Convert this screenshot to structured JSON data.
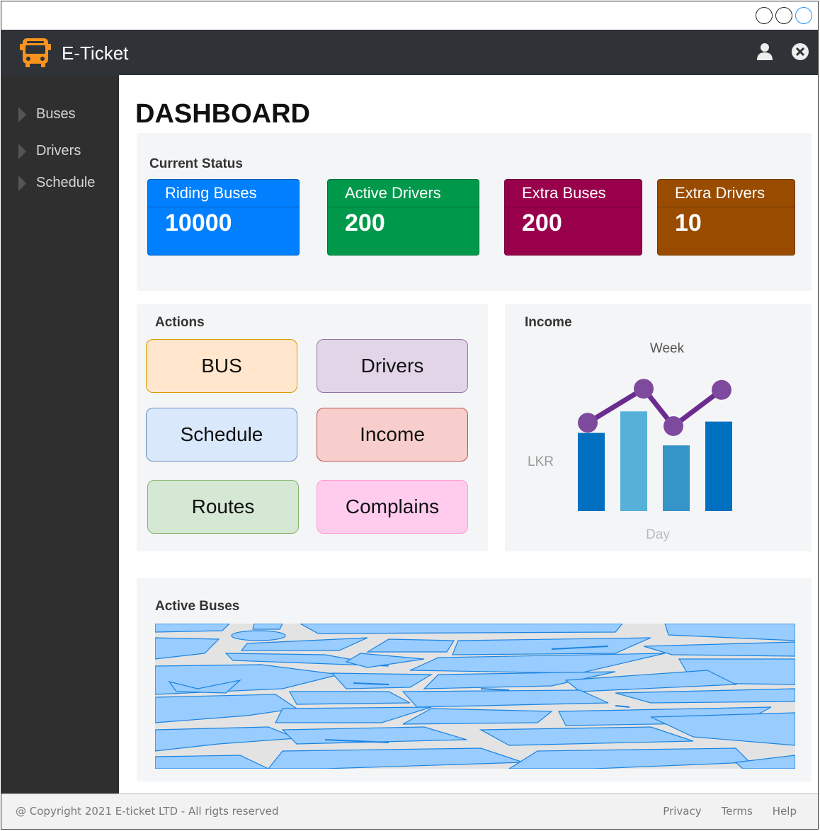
{
  "app": {
    "title": "E-Ticket"
  },
  "sidebar": {
    "items": [
      {
        "label": "Buses"
      },
      {
        "label": "Drivers"
      },
      {
        "label": "Schedule"
      }
    ]
  },
  "page": {
    "title": "DASHBOARD"
  },
  "status": {
    "title": "Current Status",
    "cards": [
      {
        "label": "Riding Buses",
        "value": "10000",
        "color": "#0080ff"
      },
      {
        "label": "Active Drivers",
        "value": "200",
        "color": "#00994c"
      },
      {
        "label": "Extra Buses",
        "value": "200",
        "color": "#99004c"
      },
      {
        "label": "Extra Drivers",
        "value": "10",
        "color": "#994c00"
      }
    ]
  },
  "actions": {
    "title": "Actions",
    "buttons": [
      {
        "label": "BUS",
        "fill": "#ffe6cc",
        "border": "#d79b00"
      },
      {
        "label": "Drivers",
        "fill": "#e1d5e7",
        "border": "#9673a6"
      },
      {
        "label": "Schedule",
        "fill": "#dae8fc",
        "border": "#6c8ebf"
      },
      {
        "label": "Income",
        "fill": "#f8cecc",
        "border": "#b85450"
      },
      {
        "label": "Routes",
        "fill": "#d5e8d4",
        "border": "#82b366"
      },
      {
        "label": "Complains",
        "fill": "#ffccee",
        "border": "#ff99cc"
      }
    ]
  },
  "income": {
    "title": "Income",
    "chart_data": {
      "type": "bar",
      "title": "Week",
      "xlabel": "Day",
      "ylabel": "LKR",
      "categories": [
        "",
        "",
        "",
        ""
      ],
      "series": [
        {
          "type": "bar",
          "values": [
            0.69,
            0.88,
            0.58,
            0.79
          ],
          "colors": [
            "#0070c0",
            "#56b0d8",
            "#3594c8",
            "#0070c0"
          ]
        },
        {
          "type": "line",
          "values": [
            0.53,
            0.83,
            0.5,
            0.82
          ],
          "color": "#6a2c8e"
        }
      ]
    }
  },
  "map": {
    "title": "Active Buses"
  },
  "footer": {
    "copyright": "@ Copyright 2021 E-ticket LTD - All rigts reserved",
    "links": [
      {
        "label": "Privacy"
      },
      {
        "label": "Terms"
      },
      {
        "label": "Help"
      }
    ]
  }
}
